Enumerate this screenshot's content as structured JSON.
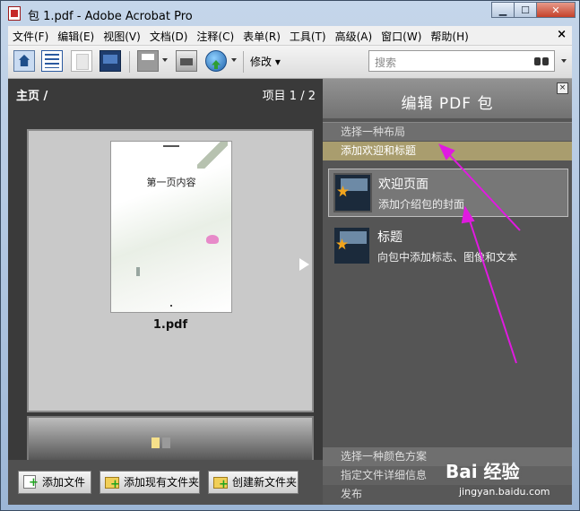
{
  "window": {
    "title": "包 1.pdf - Adobe Acrobat Pro",
    "min": "▁",
    "max": "☐",
    "close": "✕"
  },
  "menu": [
    "文件(F)",
    "编辑(E)",
    "视图(V)",
    "文档(D)",
    "注释(C)",
    "表单(R)",
    "工具(T)",
    "高级(A)",
    "窗口(W)",
    "帮助(H)"
  ],
  "menu_close": "×",
  "toolbar": {
    "modify_label": "修改",
    "search_placeholder": "搜索"
  },
  "left": {
    "breadcrumb": "主页 /",
    "counter": "项目 1 / 2",
    "doc_text": "第一页内容",
    "doc_name": "1.pdf",
    "buttons": {
      "add_file": "添加文件",
      "add_existing_folder": "添加现有文件夹",
      "create_folder": "创建新文件夹"
    }
  },
  "right": {
    "title": "编辑 PDF 包",
    "close": "×",
    "steps": {
      "layout": "选择一种布局",
      "welcome_header": "添加欢迎和标题",
      "color": "选择一种颜色方案",
      "details": "指定文件详细信息",
      "publish": "发布"
    },
    "options": [
      {
        "title": "欢迎页面",
        "desc": "添加介绍包的封面"
      },
      {
        "title": "标题",
        "desc": "向包中添加标志、图像和文本"
      }
    ]
  },
  "watermark": {
    "line1": "Bai 经验",
    "line2": "jingyan.baidu.com"
  },
  "colors": {
    "accent_arrow": "#e01ae0",
    "selected_step": "#a99d6e"
  }
}
